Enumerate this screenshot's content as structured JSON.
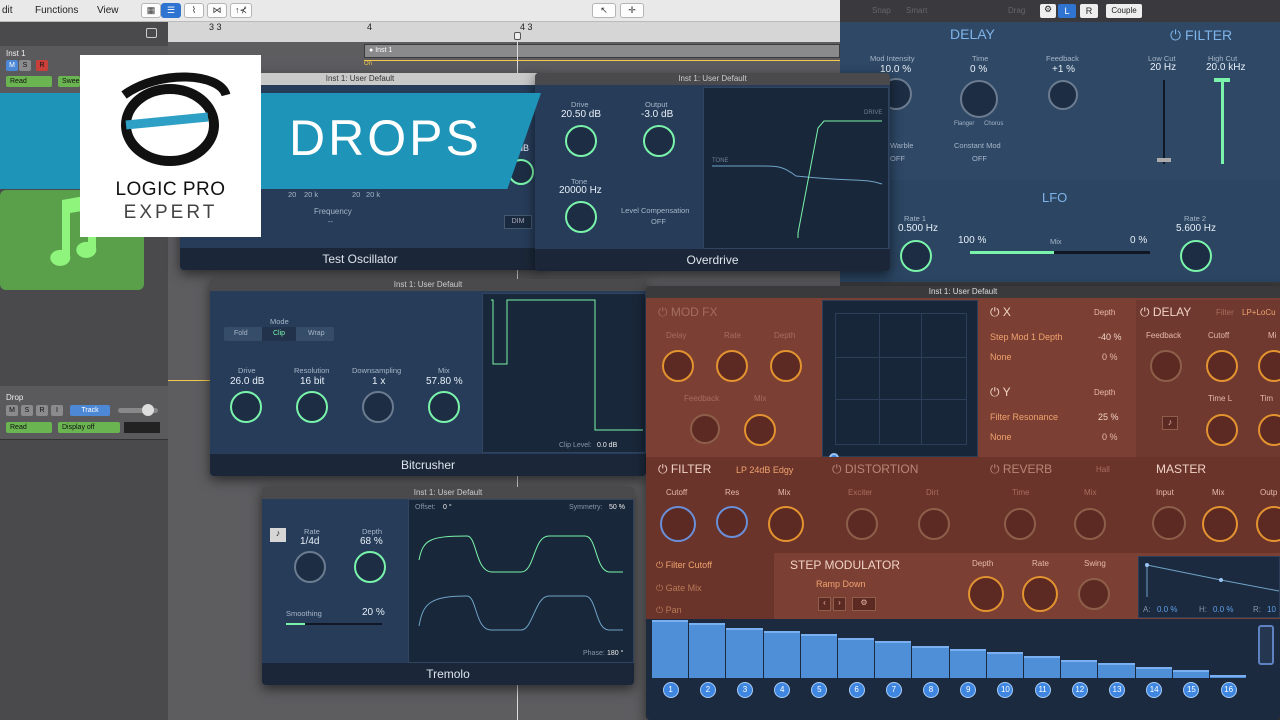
{
  "menu": {
    "edit": "dit",
    "functions": "Functions",
    "view": "View"
  },
  "ruler": {
    "m33": "3 3",
    "m4": "4",
    "m43": "4 3"
  },
  "tracks": [
    {
      "name": "Inst 1",
      "read": "Read",
      "sweep": "Swee"
    },
    {
      "name": "Drop",
      "read": "Read",
      "track_btn": "Track",
      "display": "Display off"
    }
  ],
  "region": {
    "name": "Inst 1",
    "on": "On"
  },
  "logo": {
    "line1": "LOGIC PRO",
    "line2": "EXPERT",
    "banner": "DROPS"
  },
  "delay_plugin": {
    "topbar": {
      "snap": "Snap",
      "smart": "Smart",
      "drag": "Drag",
      "l": "L",
      "r": "R",
      "couple": "Couple"
    },
    "delay_title": "DELAY",
    "filter_title": "FILTER",
    "lfo_title": "LFO",
    "mod_intensity_label": "Mod Intensity",
    "mod_intensity": "10.0 %",
    "time_label": "Time",
    "time": "0 %",
    "flanger": "Flanger",
    "chorus": "Chorus",
    "feedback_label": "Feedback",
    "feedback": "+1 %",
    "lowcut_label": "Low Cut",
    "lowcut": "20 Hz",
    "highcut_label": "High Cut",
    "highcut": "20.0 kHz",
    "warble_label": "Warble",
    "warble": "OFF",
    "constmod_label": "Constant Mod",
    "constmod": "OFF",
    "rate1_label": "Rate 1",
    "rate1": "0.500 Hz",
    "mix_left": "100 %",
    "mix_label": "Mix",
    "mix_right": "0 %",
    "rate2_label": "Rate 2",
    "rate2": "5.600 Hz"
  },
  "test_osc": {
    "title": "Inst 1: User Default",
    "frequency_label": "Frequency",
    "frequency": "--",
    "footer": "Test Oscillator",
    "dim": "DIM",
    "db": "dB",
    "t20": "20",
    "t20k": "20 k"
  },
  "overdrive": {
    "title": "Inst 1: User Default",
    "drive_label": "Drive",
    "drive": "20.50 dB",
    "output_label": "Output",
    "output": "-3.0 dB",
    "tone_label": "Tone",
    "tone": "20000 Hz",
    "level_comp_label": "Level Compensation",
    "level_comp": "OFF",
    "graph_drive": "DRIVE",
    "graph_tone": "TONE",
    "footer": "Overdrive"
  },
  "bitcrusher": {
    "title": "Inst 1: User Default",
    "mode_label": "Mode",
    "modes": [
      "Fold",
      "Clip",
      "Wrap"
    ],
    "drive_label": "Drive",
    "drive": "26.0 dB",
    "resolution_label": "Resolution",
    "resolution": "16 bit",
    "downsampling_label": "Downsampling",
    "downsampling": "1 x",
    "mix_label": "Mix",
    "mix": "57.80 %",
    "clip_level": "Clip Level:",
    "clip_level_val": "0.0 dB",
    "footer": "Bitcrusher"
  },
  "tremolo": {
    "title": "Inst 1: User Default",
    "rate_label": "Rate",
    "rate": "1/4d",
    "depth_label": "Depth",
    "depth": "68 %",
    "smoothing_label": "Smoothing",
    "smoothing": "20 %",
    "offset": "Offset:",
    "offset_val": "0 °",
    "symmetry": "Symmetry:",
    "symmetry_val": "50 %",
    "phase": "Phase:",
    "phase_val": "180 °",
    "footer": "Tremolo"
  },
  "alchemy": {
    "title": "Inst 1: User Default",
    "modfx": "MOD FX",
    "delay_l": "Delay",
    "rate_l": "Rate",
    "depth_l": "Depth",
    "feedback_l": "Feedback",
    "mix_l": "Mix",
    "x_label": "X",
    "depth": "Depth",
    "x_target": "Step Mod 1 Depth",
    "x_val": "-40 %",
    "none1": "None",
    "none1_val": "0 %",
    "y_label": "Y",
    "y_target": "Filter Resonance",
    "y_val": "25 %",
    "none2": "None",
    "none2_val": "0 %",
    "delay": "DELAY",
    "delay_filter": "Filter",
    "delay_filter_val": "LP+LoCu",
    "delay_feedback": "Feedback",
    "delay_cutoff": "Cutoff",
    "delay_mi": "Mi",
    "delay_timel": "Time L",
    "delay_time": "Tim",
    "filter": "FILTER",
    "filter_type": "LP 24dB Edgy",
    "cutoff": "Cutoff",
    "res": "Res",
    "fmix": "Mix",
    "distortion": "DISTORTION",
    "exciter": "Exciter",
    "dirt": "Dirt",
    "reverb": "REVERB",
    "reverb_type": "Hall",
    "rtime": "Time",
    "rmix": "Mix",
    "master": "MASTER",
    "input": "Input",
    "mmix": "Mix",
    "output": "Outp",
    "targets": [
      "Filter Cutoff",
      "Gate Mix",
      "Pan"
    ],
    "step_mod": "STEP MODULATOR",
    "step_preset": "Ramp Down",
    "smdepth": "Depth",
    "smrate": "Rate",
    "smswing": "Swing",
    "env_a": "A:",
    "env_a_val": "0.0 %",
    "env_h": "H:",
    "env_h_val": "0.0 %",
    "env_r": "R:",
    "env_r_val": "10",
    "steps": [
      "1",
      "2",
      "3",
      "4",
      "5",
      "6",
      "7",
      "8",
      "9",
      "10",
      "11",
      "12",
      "13",
      "14",
      "15",
      "16"
    ],
    "step_levels": [
      1.0,
      0.94,
      0.87,
      0.81,
      0.75,
      0.69,
      0.63,
      0.56,
      0.5,
      0.44,
      0.38,
      0.31,
      0.25,
      0.19,
      0.13,
      0.06
    ]
  }
}
